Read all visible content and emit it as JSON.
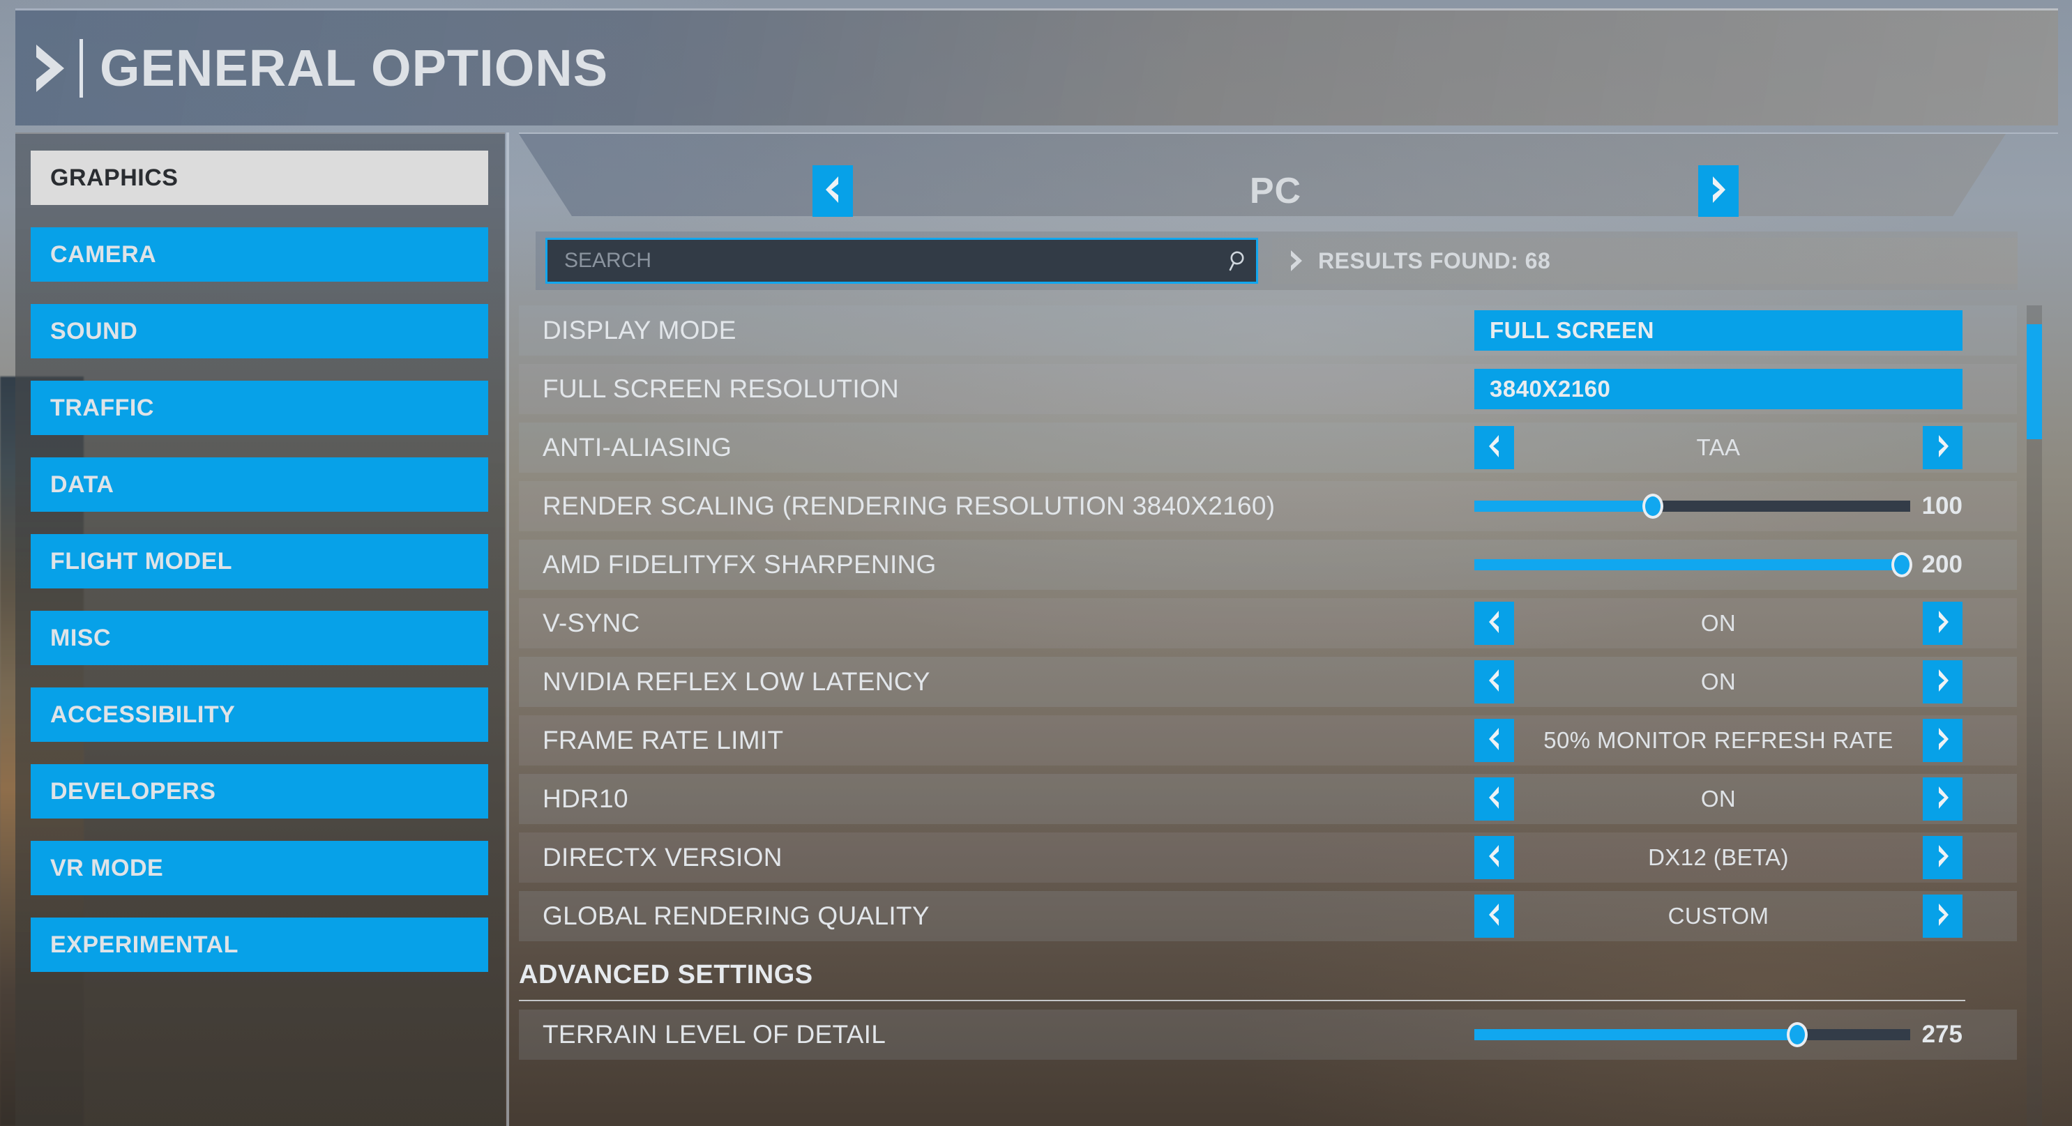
{
  "header": {
    "title": "GENERAL OPTIONS",
    "chevron_icon": "chevron-right-icon"
  },
  "sidebar": {
    "items": [
      {
        "label": "GRAPHICS",
        "selected": true
      },
      {
        "label": "CAMERA",
        "selected": false
      },
      {
        "label": "SOUND",
        "selected": false
      },
      {
        "label": "TRAFFIC",
        "selected": false
      },
      {
        "label": "DATA",
        "selected": false
      },
      {
        "label": "FLIGHT MODEL",
        "selected": false
      },
      {
        "label": "MISC",
        "selected": false
      },
      {
        "label": "ACCESSIBILITY",
        "selected": false
      },
      {
        "label": "DEVELOPERS",
        "selected": false
      },
      {
        "label": "VR MODE",
        "selected": false
      },
      {
        "label": "EXPERIMENTAL",
        "selected": false
      }
    ]
  },
  "tabs": {
    "current": "PC",
    "prev_icon": "chevron-left-icon",
    "next_icon": "chevron-right-icon"
  },
  "search": {
    "placeholder": "SEARCH",
    "value": "",
    "icon": "search-icon",
    "results_chevron_icon": "chevron-right-icon",
    "results_text": "RESULTS FOUND: 68"
  },
  "settings": [
    {
      "type": "dropdown",
      "label": "DISPLAY MODE",
      "value": "FULL SCREEN"
    },
    {
      "type": "dropdown",
      "label": "FULL SCREEN RESOLUTION",
      "value": "3840X2160"
    },
    {
      "type": "stepper",
      "label": "ANTI-ALIASING",
      "value": "TAA"
    },
    {
      "type": "slider",
      "label": "RENDER SCALING (RENDERING RESOLUTION 3840X2160)",
      "value": "100",
      "fill_percent": 41
    },
    {
      "type": "slider",
      "label": "AMD FIDELITYFX SHARPENING",
      "value": "200",
      "fill_percent": 98
    },
    {
      "type": "stepper",
      "label": "V-SYNC",
      "value": "ON"
    },
    {
      "type": "stepper",
      "label": "NVIDIA REFLEX LOW LATENCY",
      "value": "ON"
    },
    {
      "type": "stepper",
      "label": "FRAME RATE LIMIT",
      "value": "50% MONITOR REFRESH RATE"
    },
    {
      "type": "stepper",
      "label": "HDR10",
      "value": "ON"
    },
    {
      "type": "stepper",
      "label": "DIRECTX VERSION",
      "value": "DX12 (BETA)"
    },
    {
      "type": "stepper",
      "label": "GLOBAL RENDERING QUALITY",
      "value": "CUSTOM"
    },
    {
      "type": "section",
      "label": "ADVANCED SETTINGS"
    },
    {
      "type": "slider",
      "label": "TERRAIN LEVEL OF DETAIL",
      "value": "275",
      "fill_percent": 74
    }
  ],
  "scrollbar": {
    "thumb_top_percent": 2.3,
    "thumb_height_percent": 14
  },
  "colors": {
    "accent_blue": "#07a1e8",
    "accent_blue_bright": "#11a7ef",
    "selected_item_bg": "#dcdcdc",
    "text_light": "#dfe3e7",
    "slider_track": "#333c48",
    "search_bg": "#323b46"
  }
}
